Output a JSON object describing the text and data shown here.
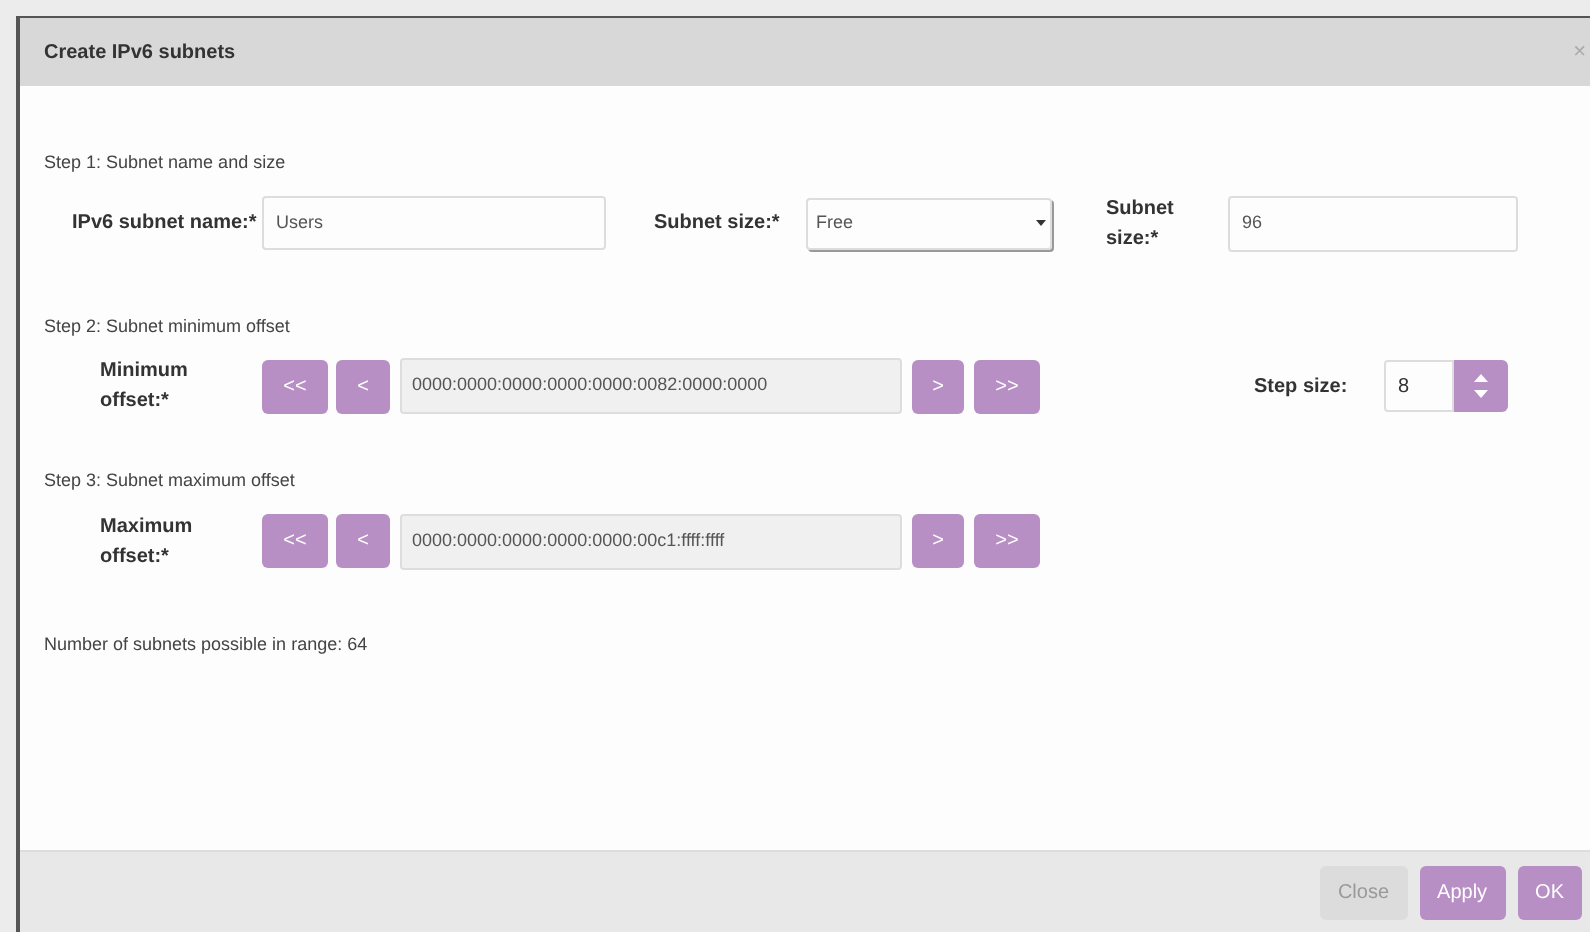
{
  "window": {
    "title": "Create IPv6 subnets",
    "close": "×"
  },
  "step1": {
    "heading": "Step 1: Subnet name and size",
    "name_label": "IPv6 subnet name:*",
    "name_value": "Users",
    "type_label": "Subnet size:*",
    "type_value": "Free",
    "size_label": "Subnet size:*",
    "size_value": "96"
  },
  "step2": {
    "heading": "Step 2: Subnet minimum offset",
    "label": "Minimum offset:*",
    "first": "<<",
    "prev": "<",
    "value": "0000:0000:0000:0000:0000:0082:0000:0000",
    "next": ">",
    "last": ">>",
    "step_label": "Step size:",
    "step_value": "8"
  },
  "step3": {
    "heading": "Step 3: Subnet maximum offset",
    "label": "Maximum offset:*",
    "first": "<<",
    "prev": "<",
    "value": "0000:0000:0000:0000:0000:00c1:ffff:ffff",
    "next": ">",
    "last": ">>"
  },
  "summary": "Number of subnets possible in range: 64",
  "buttons": [
    {
      "label": "Close",
      "kind": "secondary"
    },
    {
      "label": "Apply",
      "kind": "primary"
    },
    {
      "label": "OK",
      "kind": "primary"
    }
  ]
}
